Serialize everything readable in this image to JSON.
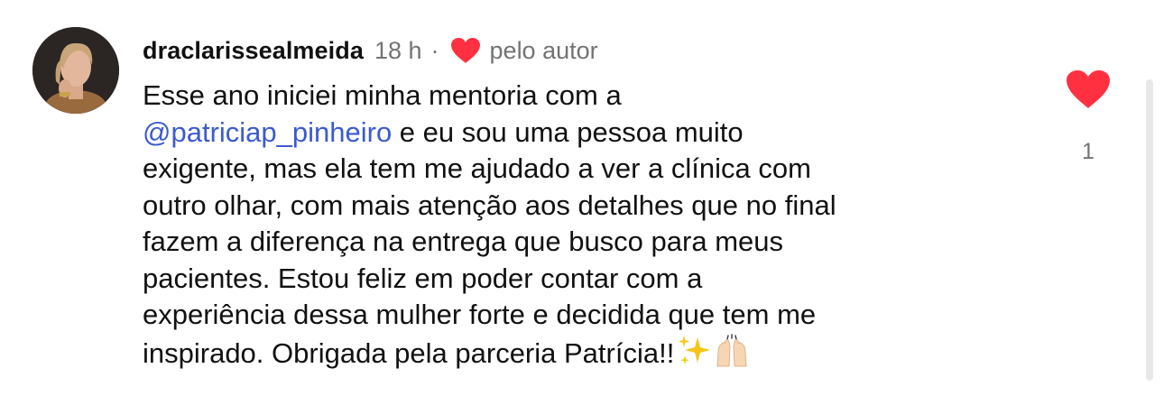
{
  "comment": {
    "username": "draclarissealmeida",
    "time": "18 h",
    "separator": "·",
    "author_badge_label": "pelo autor",
    "mention": "@patriciap_pinheiro",
    "lines": [
      "Esse ano iniciei minha mentoria com a",
      " e eu sou uma pessoa muito",
      "exigente, mas ela tem me ajudado a ver a clínica com",
      "outro olhar, com mais atenção aos detalhes que no final",
      "fazem a diferença na entrega que busco para meus",
      "pacientes. Estou feliz em poder contar com a",
      "experiência dessa mulher forte e decidida que tem me",
      "inspirado. Obrigada pela parceria Patrícia!!"
    ],
    "emojis": [
      "sparkles-icon",
      "raising-hands-icon"
    ]
  },
  "like": {
    "count": "1",
    "icon": "heart-filled-icon",
    "color": "#ff3040"
  },
  "colors": {
    "text": "#111111",
    "secondary": "#737373",
    "mention": "#3b5ad1",
    "heart": "#ff3040"
  }
}
